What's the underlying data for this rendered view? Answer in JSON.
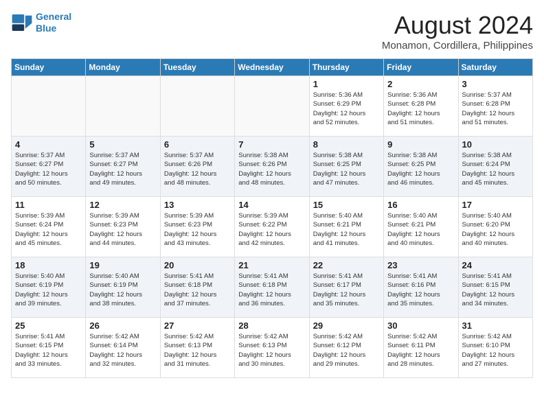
{
  "header": {
    "logo_line1": "General",
    "logo_line2": "Blue",
    "title": "August 2024",
    "subtitle": "Monamon, Cordillera, Philippines"
  },
  "weekdays": [
    "Sunday",
    "Monday",
    "Tuesday",
    "Wednesday",
    "Thursday",
    "Friday",
    "Saturday"
  ],
  "weeks": [
    [
      {
        "day": "",
        "info": ""
      },
      {
        "day": "",
        "info": ""
      },
      {
        "day": "",
        "info": ""
      },
      {
        "day": "",
        "info": ""
      },
      {
        "day": "1",
        "info": "Sunrise: 5:36 AM\nSunset: 6:29 PM\nDaylight: 12 hours\nand 52 minutes."
      },
      {
        "day": "2",
        "info": "Sunrise: 5:36 AM\nSunset: 6:28 PM\nDaylight: 12 hours\nand 51 minutes."
      },
      {
        "day": "3",
        "info": "Sunrise: 5:37 AM\nSunset: 6:28 PM\nDaylight: 12 hours\nand 51 minutes."
      }
    ],
    [
      {
        "day": "4",
        "info": "Sunrise: 5:37 AM\nSunset: 6:27 PM\nDaylight: 12 hours\nand 50 minutes."
      },
      {
        "day": "5",
        "info": "Sunrise: 5:37 AM\nSunset: 6:27 PM\nDaylight: 12 hours\nand 49 minutes."
      },
      {
        "day": "6",
        "info": "Sunrise: 5:37 AM\nSunset: 6:26 PM\nDaylight: 12 hours\nand 48 minutes."
      },
      {
        "day": "7",
        "info": "Sunrise: 5:38 AM\nSunset: 6:26 PM\nDaylight: 12 hours\nand 48 minutes."
      },
      {
        "day": "8",
        "info": "Sunrise: 5:38 AM\nSunset: 6:25 PM\nDaylight: 12 hours\nand 47 minutes."
      },
      {
        "day": "9",
        "info": "Sunrise: 5:38 AM\nSunset: 6:25 PM\nDaylight: 12 hours\nand 46 minutes."
      },
      {
        "day": "10",
        "info": "Sunrise: 5:38 AM\nSunset: 6:24 PM\nDaylight: 12 hours\nand 45 minutes."
      }
    ],
    [
      {
        "day": "11",
        "info": "Sunrise: 5:39 AM\nSunset: 6:24 PM\nDaylight: 12 hours\nand 45 minutes."
      },
      {
        "day": "12",
        "info": "Sunrise: 5:39 AM\nSunset: 6:23 PM\nDaylight: 12 hours\nand 44 minutes."
      },
      {
        "day": "13",
        "info": "Sunrise: 5:39 AM\nSunset: 6:23 PM\nDaylight: 12 hours\nand 43 minutes."
      },
      {
        "day": "14",
        "info": "Sunrise: 5:39 AM\nSunset: 6:22 PM\nDaylight: 12 hours\nand 42 minutes."
      },
      {
        "day": "15",
        "info": "Sunrise: 5:40 AM\nSunset: 6:21 PM\nDaylight: 12 hours\nand 41 minutes."
      },
      {
        "day": "16",
        "info": "Sunrise: 5:40 AM\nSunset: 6:21 PM\nDaylight: 12 hours\nand 40 minutes."
      },
      {
        "day": "17",
        "info": "Sunrise: 5:40 AM\nSunset: 6:20 PM\nDaylight: 12 hours\nand 40 minutes."
      }
    ],
    [
      {
        "day": "18",
        "info": "Sunrise: 5:40 AM\nSunset: 6:19 PM\nDaylight: 12 hours\nand 39 minutes."
      },
      {
        "day": "19",
        "info": "Sunrise: 5:40 AM\nSunset: 6:19 PM\nDaylight: 12 hours\nand 38 minutes."
      },
      {
        "day": "20",
        "info": "Sunrise: 5:41 AM\nSunset: 6:18 PM\nDaylight: 12 hours\nand 37 minutes."
      },
      {
        "day": "21",
        "info": "Sunrise: 5:41 AM\nSunset: 6:18 PM\nDaylight: 12 hours\nand 36 minutes."
      },
      {
        "day": "22",
        "info": "Sunrise: 5:41 AM\nSunset: 6:17 PM\nDaylight: 12 hours\nand 35 minutes."
      },
      {
        "day": "23",
        "info": "Sunrise: 5:41 AM\nSunset: 6:16 PM\nDaylight: 12 hours\nand 35 minutes."
      },
      {
        "day": "24",
        "info": "Sunrise: 5:41 AM\nSunset: 6:15 PM\nDaylight: 12 hours\nand 34 minutes."
      }
    ],
    [
      {
        "day": "25",
        "info": "Sunrise: 5:41 AM\nSunset: 6:15 PM\nDaylight: 12 hours\nand 33 minutes."
      },
      {
        "day": "26",
        "info": "Sunrise: 5:42 AM\nSunset: 6:14 PM\nDaylight: 12 hours\nand 32 minutes."
      },
      {
        "day": "27",
        "info": "Sunrise: 5:42 AM\nSunset: 6:13 PM\nDaylight: 12 hours\nand 31 minutes."
      },
      {
        "day": "28",
        "info": "Sunrise: 5:42 AM\nSunset: 6:13 PM\nDaylight: 12 hours\nand 30 minutes."
      },
      {
        "day": "29",
        "info": "Sunrise: 5:42 AM\nSunset: 6:12 PM\nDaylight: 12 hours\nand 29 minutes."
      },
      {
        "day": "30",
        "info": "Sunrise: 5:42 AM\nSunset: 6:11 PM\nDaylight: 12 hours\nand 28 minutes."
      },
      {
        "day": "31",
        "info": "Sunrise: 5:42 AM\nSunset: 6:10 PM\nDaylight: 12 hours\nand 27 minutes."
      }
    ]
  ]
}
